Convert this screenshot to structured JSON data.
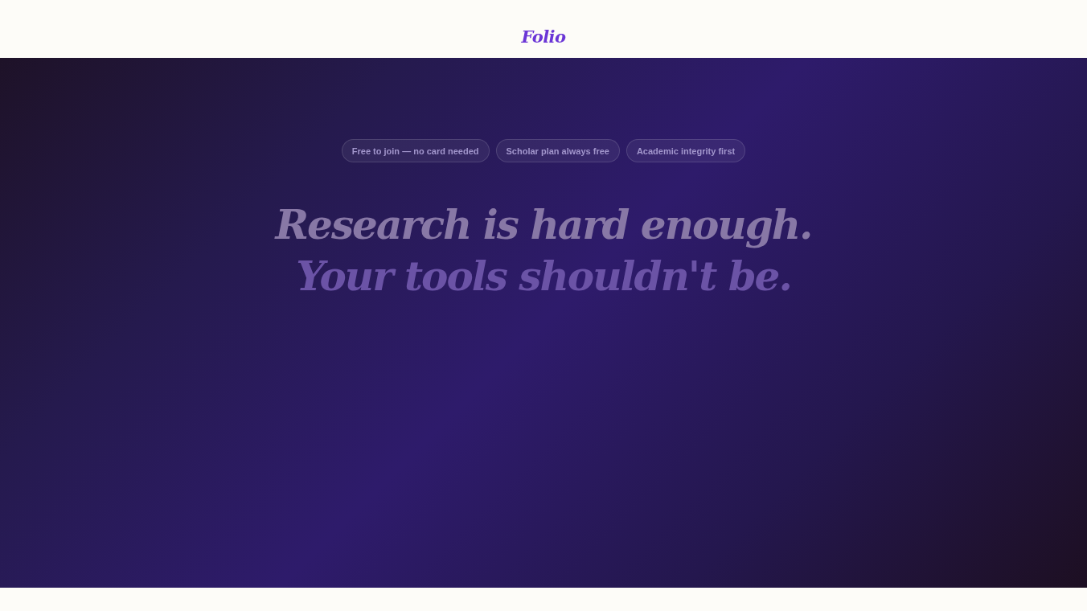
{
  "header": {
    "logo": "Folio"
  },
  "hero": {
    "badges": [
      "Free to join — no card needed",
      "Scholar plan always free",
      "Academic integrity first"
    ],
    "headline": [
      "Research is hard enough.",
      "Your tools shouldn't be."
    ]
  }
}
